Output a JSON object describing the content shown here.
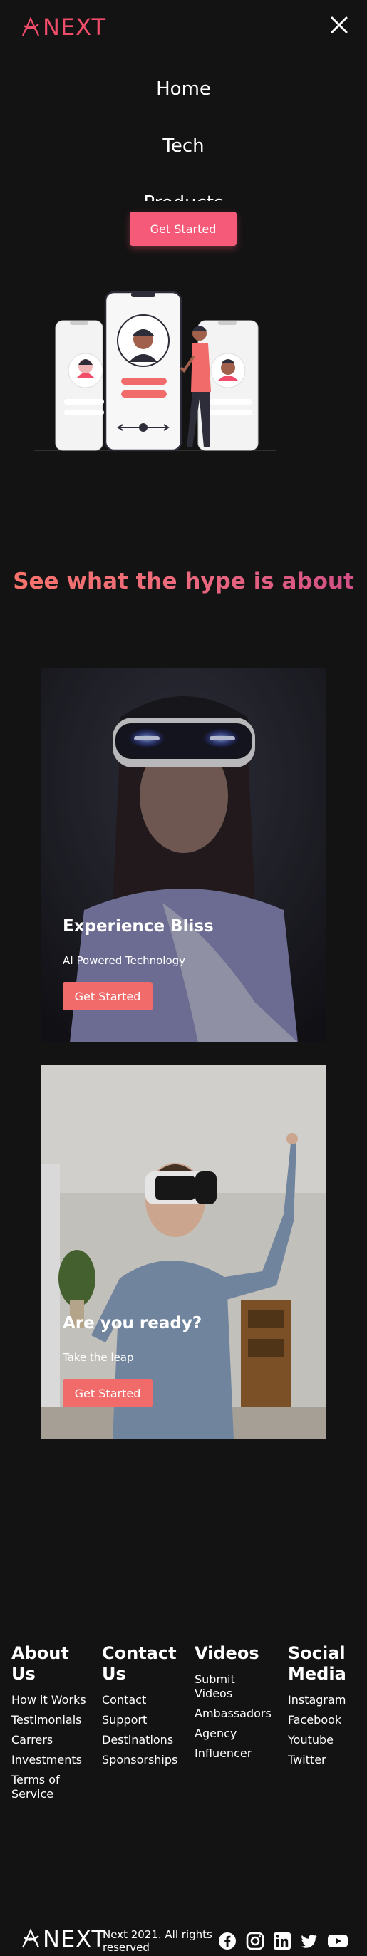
{
  "brand": {
    "name": "NEXT"
  },
  "nav": {
    "items": [
      "Home",
      "Tech",
      "Products"
    ]
  },
  "hero": {
    "cta_label": "Get Started"
  },
  "headline": {
    "part1": "See what the hype",
    "part2": " is about"
  },
  "cards": [
    {
      "title": "Experience Bliss",
      "subtitle": "AI Powered Technology",
      "button": "Get Started"
    },
    {
      "title": "Are you ready?",
      "subtitle": "Take the leap",
      "button": "Get Started"
    }
  ],
  "footer": {
    "columns": [
      {
        "heading": "About Us",
        "links": [
          "How it Works",
          "Testimonials",
          "Carrers",
          "Investments",
          "Terms of Service"
        ]
      },
      {
        "heading": "Contact Us",
        "links": [
          "Contact",
          "Support",
          "Destinations",
          "Sponsorships"
        ]
      },
      {
        "heading": "Videos",
        "links": [
          "Submit Videos",
          "Ambassadors",
          "Agency",
          "Influencer"
        ]
      },
      {
        "heading": "Social Media",
        "links": [
          "Instagram",
          "Facebook",
          "Youtube",
          "Twitter"
        ]
      }
    ],
    "copyright": "Next 2021. All rights reserved",
    "social_icons": [
      "facebook-icon",
      "instagram-icon",
      "linkedin-icon",
      "twitter-icon",
      "youtube-icon"
    ]
  },
  "colors": {
    "accent": "#f55a78",
    "background": "#131313",
    "button": "#f16b6b"
  }
}
